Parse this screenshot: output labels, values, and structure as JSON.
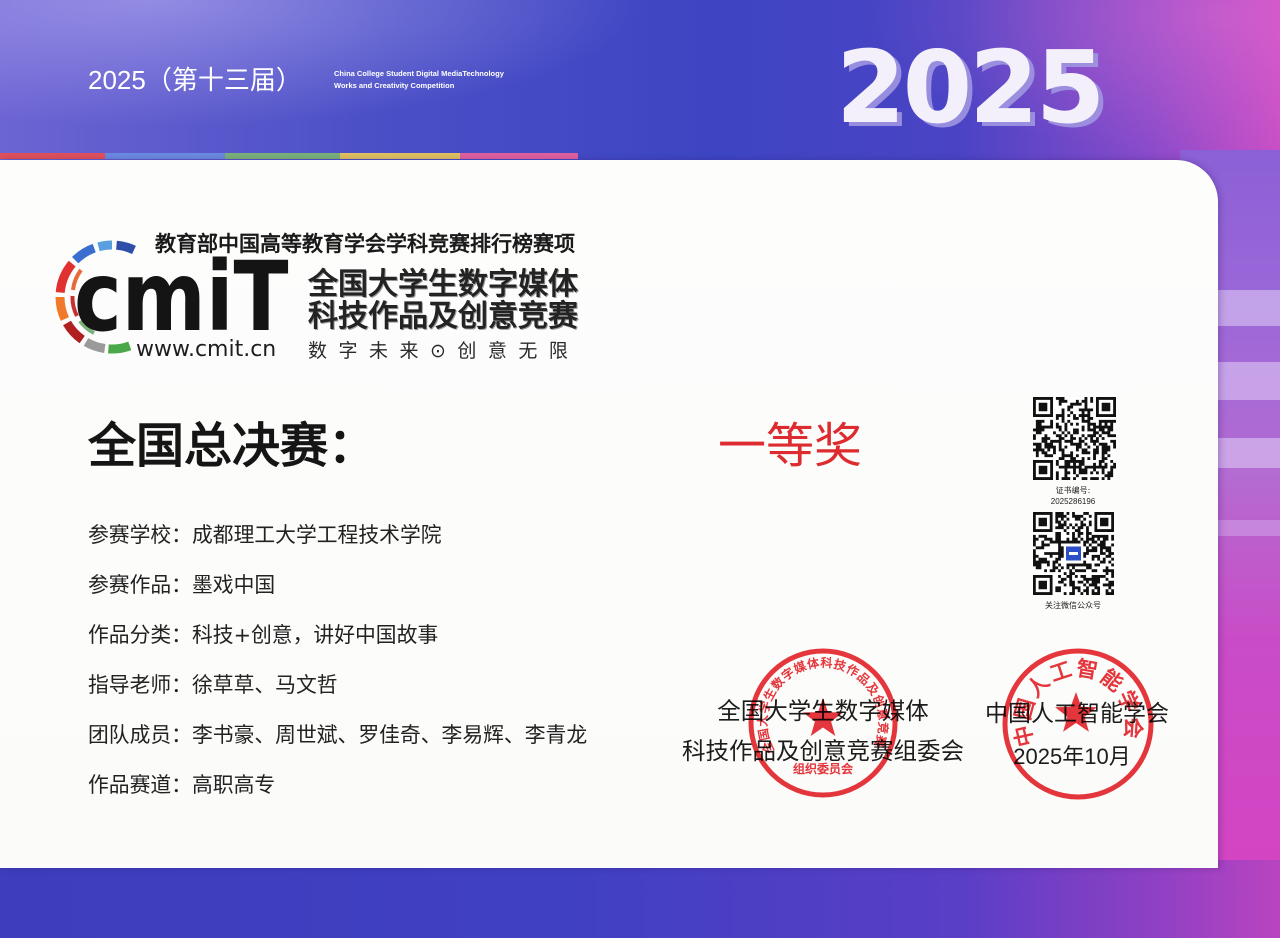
{
  "banner": {
    "edition": "2025（第十三届）",
    "english_line1": "China College Student Digital MediaTechnology",
    "english_line2": "Works and Creativity Competition",
    "year_mark": "2025"
  },
  "logo": {
    "ranking_line": "教育部中国高等教育学会学科竞赛排行榜赛项",
    "mark": "cmiT",
    "name_line1": "全国大学生数字媒体",
    "name_line2": "科技作品及创意竞赛",
    "website": "www.cmit.cn",
    "slogan": "数字未来⊙创意无限"
  },
  "award": {
    "stage": "全国总决赛：",
    "prize": "一等奖"
  },
  "details": [
    {
      "label": "参赛学校：",
      "value": "成都理工大学工程技术学院"
    },
    {
      "label": "参赛作品：",
      "value": "墨戏中国"
    },
    {
      "label": "作品分类：",
      "value": "科技+创意，讲好中国故事"
    },
    {
      "label": "指导老师：",
      "value": "徐草草、马文哲"
    },
    {
      "label": "团队成员：",
      "value": "李书豪、周世斌、罗佳奇、李易辉、李青龙"
    },
    {
      "label": "作品赛道：",
      "value": "高职高专"
    }
  ],
  "qr": {
    "cert_no_label": "证书编号:",
    "cert_no": "2025286196",
    "wechat_caption": "关注微信公众号"
  },
  "issuers": {
    "committee_line1": "全国大学生数字媒体",
    "committee_line2": "科技作品及创意竞赛组委会",
    "society": "中国人工智能学会",
    "date": "2025年10月"
  },
  "seals": {
    "committee_arc": "全国大学生数字媒体科技作品及创意竞赛",
    "committee_bottom": "组织委员会",
    "society_arc": "中国人工智能学会"
  },
  "colors": {
    "prize_red": "#dd2b2f",
    "seal_red": "#e5262c",
    "banner_blue": "#3f47c2",
    "stripe": [
      "#e0505a",
      "#6a8ae0",
      "#7ab07a",
      "#e0c060",
      "#e060a0"
    ]
  },
  "icons": {
    "logo_ring": "cmit-logo-ring-icon",
    "seal_star": "star-icon",
    "wechat_logo": "cmit-mini-logo-icon"
  }
}
